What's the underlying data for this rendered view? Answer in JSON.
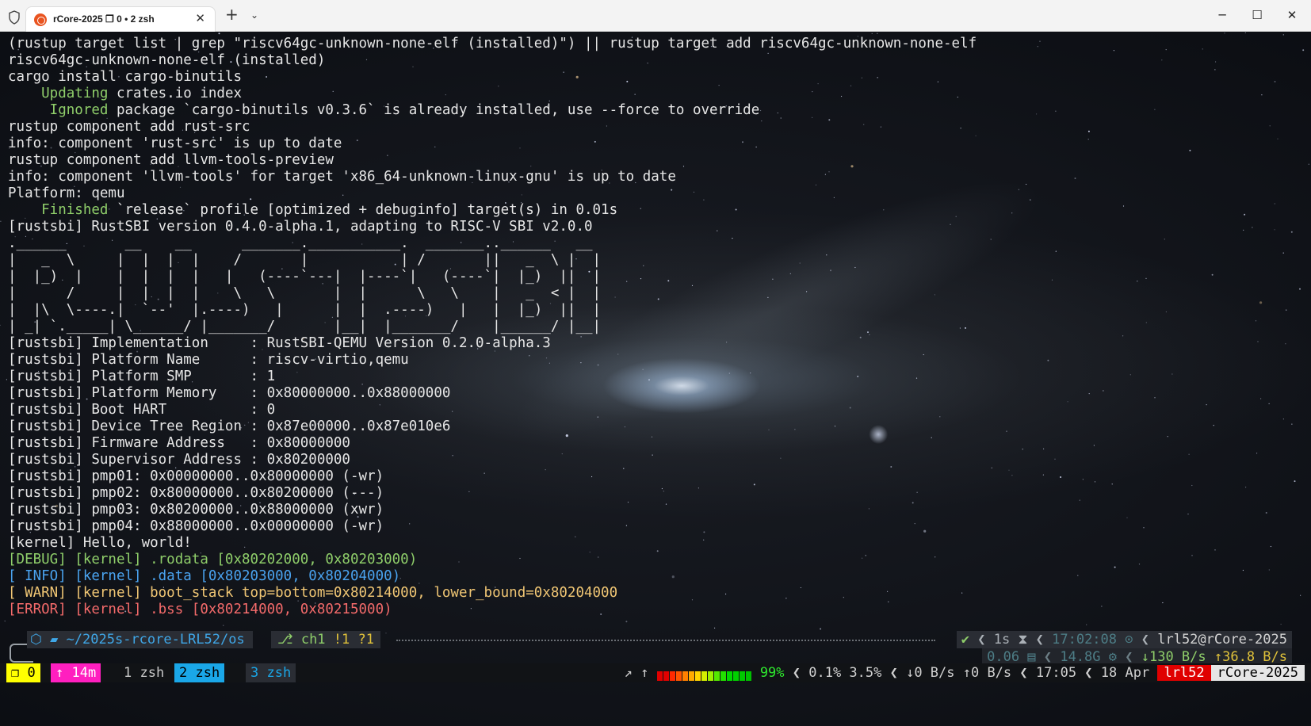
{
  "window": {
    "tab_title": "rCore-2025 ❐ 0 • 2 zsh",
    "new_tab_glyph": "+",
    "tab_menu_glyph": "⌄",
    "close_tab_glyph": "✕",
    "minimize_glyph": "─",
    "maximize_glyph": "☐",
    "close_glyph": "✕",
    "brand_color": "#e95420"
  },
  "terminal": {
    "lines": [
      {
        "text": "(rustup target list | grep \"riscv64gc-unknown-none-elf (installed)\") || rustup target add riscv64gc-unknown-none-elf",
        "style": "plain"
      },
      {
        "text": "riscv64gc-unknown-none-elf (installed)",
        "style": "plain"
      },
      {
        "text": "cargo install cargo-binutils",
        "style": "plain"
      },
      {
        "prefix": "    Updating",
        "text": " crates.io index",
        "style": "green-prefix"
      },
      {
        "prefix": "     Ignored",
        "text": " package `cargo-binutils v0.3.6` is already installed, use --force to override",
        "style": "green-prefix"
      },
      {
        "text": "rustup component add rust-src",
        "style": "plain"
      },
      {
        "text": "info: component 'rust-src' is up to date",
        "style": "plain"
      },
      {
        "text": "rustup component add llvm-tools-preview",
        "style": "plain"
      },
      {
        "text": "info: component 'llvm-tools' for target 'x86_64-unknown-linux-gnu' is up to date",
        "style": "plain"
      },
      {
        "text": "Platform: qemu",
        "style": "plain"
      },
      {
        "prefix": "    Finished",
        "text": " `release` profile [optimized + debuginfo] target(s) in 0.01s",
        "style": "green-prefix"
      },
      {
        "text": "[rustsbi] RustSBI version 0.4.0-alpha.1, adapting to RISC-V SBI v2.0.0",
        "style": "plain"
      },
      {
        "text": ".______       __    __      _______.___________.  _______..______   __",
        "style": "plain"
      },
      {
        "text": "|   _  \\     |  |  |  |    /       |           | /       ||   _  \\ |  |",
        "style": "plain"
      },
      {
        "text": "|  |_)  |    |  |  |  |   |   (----`---|  |----`|   (----`|  |_)  ||  |",
        "style": "plain"
      },
      {
        "text": "|      /     |  |  |  |    \\   \\       |  |      \\   \\    |   _  < |  |",
        "style": "plain"
      },
      {
        "text": "|  |\\  \\----.|  `--'  |.----)   |      |  |  .----)   |   |  |_)  ||  |",
        "style": "plain"
      },
      {
        "text": "| _| `._____| \\______/ |_______/       |__|  |_______/    |______/ |__|",
        "style": "plain"
      },
      {
        "text": "[rustsbi] Implementation     : RustSBI-QEMU Version 0.2.0-alpha.3",
        "style": "plain"
      },
      {
        "text": "[rustsbi] Platform Name      : riscv-virtio,qemu",
        "style": "plain"
      },
      {
        "text": "[rustsbi] Platform SMP       : 1",
        "style": "plain"
      },
      {
        "text": "[rustsbi] Platform Memory    : 0x80000000..0x88000000",
        "style": "plain"
      },
      {
        "text": "[rustsbi] Boot HART          : 0",
        "style": "plain"
      },
      {
        "text": "[rustsbi] Device Tree Region : 0x87e00000..0x87e010e6",
        "style": "plain"
      },
      {
        "text": "[rustsbi] Firmware Address   : 0x80000000",
        "style": "plain"
      },
      {
        "text": "[rustsbi] Supervisor Address : 0x80200000",
        "style": "plain"
      },
      {
        "text": "[rustsbi] pmp01: 0x00000000..0x80000000 (-wr)",
        "style": "plain"
      },
      {
        "text": "[rustsbi] pmp02: 0x80000000..0x80200000 (---)",
        "style": "plain"
      },
      {
        "text": "[rustsbi] pmp03: 0x80200000..0x88000000 (xwr)",
        "style": "plain"
      },
      {
        "text": "[rustsbi] pmp04: 0x88000000..0x00000000 (-wr)",
        "style": "plain"
      },
      {
        "text": "[kernel] Hello, world!",
        "style": "plain"
      },
      {
        "text": "[DEBUG] [kernel] .rodata [0x80202000, 0x80203000)",
        "style": "debug"
      },
      {
        "text": "[ INFO] [kernel] .data [0x80203000, 0x80204000)",
        "style": "info"
      },
      {
        "text": "[ WARN] [kernel] boot_stack top=bottom=0x80214000, lower_bound=0x80204000",
        "style": "warn"
      },
      {
        "text": "[ERROR] [kernel] .bss [0x80214000, 0x80215000)",
        "style": "error"
      }
    ]
  },
  "prompt": {
    "os_icon": "",
    "dir": "~/2025s-rcore-LRL52/os",
    "git_branch": "ch1",
    "git_status": "!1 ?1",
    "right_line1": {
      "status": "✔",
      "duration": "1s",
      "time": "17:02:08",
      "user_host": "lrl52@rCore-2025"
    },
    "right_line2": {
      "load": "0.06",
      "ram": "14.8G",
      "net_down": "↓130 B/s",
      "net_up": "↑36.8 B/s"
    }
  },
  "tmux": {
    "session": "❐ 0",
    "uptime": "↑ 14m",
    "windows": [
      "1 zsh",
      "2 zsh",
      "3 zsh"
    ],
    "battery_arrows": "↗ ↑",
    "battery_pct": "99%",
    "cpu": "0.1% 3.5%",
    "net": "↓0 B/s ↑0 B/s",
    "clock": "17:05",
    "date": "18 Apr",
    "user": "lrl52",
    "host": "rCore-2025"
  }
}
